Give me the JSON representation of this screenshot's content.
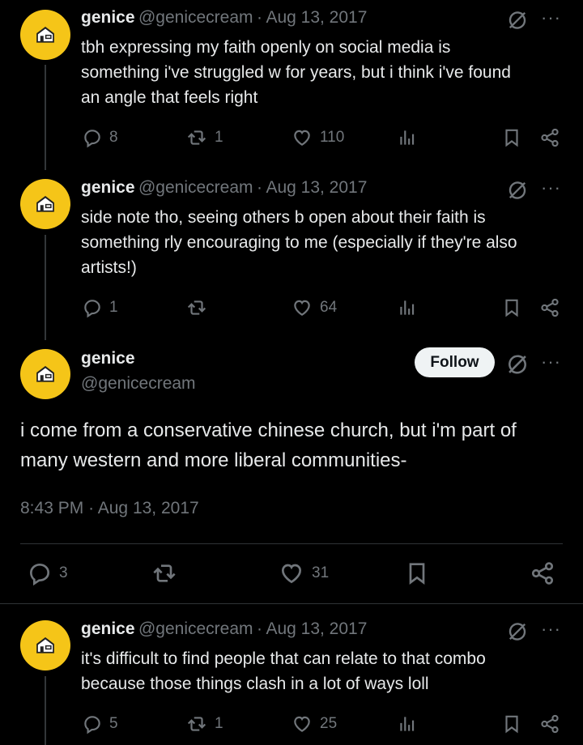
{
  "colors": {
    "background": "#000000",
    "text": "#e7e9ea",
    "muted": "#71767b",
    "avatar": "#f5c518",
    "follow_bg": "#eff3f4"
  },
  "tweets": [
    {
      "name": "genice",
      "handle": "@genicecream",
      "sep": "·",
      "date": "Aug 13, 2017",
      "lines": [
        "tbh expressing my faith openly on social media is",
        "something i've struggled w for years, but i think i've found",
        "an angle that feels right"
      ],
      "replies": "8",
      "retweets": "1",
      "likes": "110"
    },
    {
      "name": "genice",
      "handle": "@genicecream",
      "sep": "·",
      "date": "Aug 13, 2017",
      "lines": [
        "side note tho, seeing others b open about their faith is",
        "something rly encouraging to me (especially if they're also",
        "artists!)"
      ],
      "replies": "1",
      "retweets": "",
      "likes": "64"
    }
  ],
  "main_tweet": {
    "name": "genice",
    "handle": "@genicecream",
    "follow_label": "Follow",
    "lines": [
      "i come from a conservative chinese church, but i'm part of",
      "many western and more liberal communities-"
    ],
    "time": "8:43 PM",
    "sep": "·",
    "date": "Aug 13, 2017",
    "replies": "3",
    "retweets": "",
    "likes": "31"
  },
  "reply_tweet": {
    "name": "genice",
    "handle": "@genicecream",
    "sep": "·",
    "date": "Aug 13, 2017",
    "lines": [
      "it's difficult to find people that can relate to that combo",
      "because those things clash in a lot of ways loll"
    ],
    "replies": "5",
    "retweets": "1",
    "likes": "25"
  },
  "icons": {
    "reply": "reply-icon",
    "retweet": "retweet-icon",
    "like": "heart-icon",
    "views": "views-icon",
    "bookmark": "bookmark-icon",
    "share": "share-icon",
    "grok": "grok-icon",
    "more": "more-icon",
    "avatar": "house-avatar-icon"
  }
}
